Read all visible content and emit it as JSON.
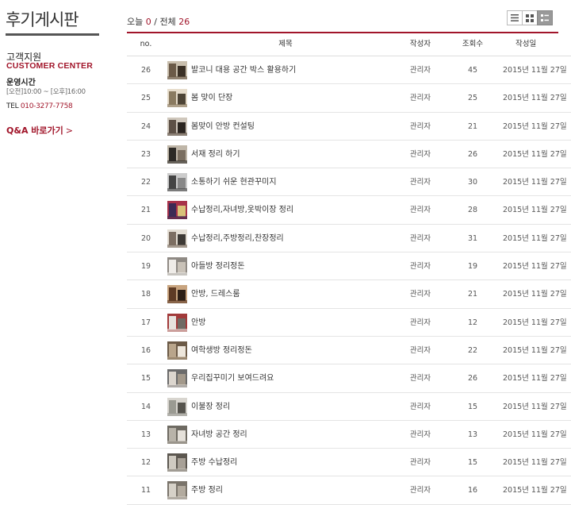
{
  "sidebar": {
    "board_title": "후기게시판",
    "cs_title": "고객지원",
    "cs_en": "CUSTOMER CENTER",
    "hours_label": "운영시간",
    "hours_value": "[오전]10:00 ~ [오후]16:00",
    "tel_label": "TEL",
    "tel_number": "010-3277-7758",
    "qna_link": "Q&A 바로가기",
    "qna_chevron": ">"
  },
  "counts": {
    "today_label": "오늘",
    "today_value": "0",
    "separator": "/",
    "total_label": "전체",
    "total_value": "26"
  },
  "view_modes": [
    "list-view-icon",
    "gallery-view-icon",
    "thumbnail-list-view-icon"
  ],
  "active_view": "thumbnail-list-view-icon",
  "table": {
    "headers": {
      "no": "no.",
      "subject": "제목",
      "writer": "작성자",
      "views": "조회수",
      "date": "작성일"
    },
    "rows": [
      {
        "no": "26",
        "title": "발코니 대용 공간 박스 활용하기",
        "writer": "관리자",
        "views": "45",
        "date": "2015년 11월 27일"
      },
      {
        "no": "25",
        "title": "봄 맞이 단장",
        "writer": "관리자",
        "views": "25",
        "date": "2015년 11월 27일"
      },
      {
        "no": "24",
        "title": "봄맞이 안방 컨설팅",
        "writer": "관리자",
        "views": "21",
        "date": "2015년 11월 27일"
      },
      {
        "no": "23",
        "title": "서재 정리 하기",
        "writer": "관리자",
        "views": "26",
        "date": "2015년 11월 27일"
      },
      {
        "no": "22",
        "title": "소통하기 쉬운 현관꾸미지",
        "writer": "관리자",
        "views": "30",
        "date": "2015년 11월 27일"
      },
      {
        "no": "21",
        "title": "수납정리,자녀방,옷박이장 정리",
        "writer": "관리자",
        "views": "28",
        "date": "2015년 11월 27일"
      },
      {
        "no": "20",
        "title": "수납정리,주방정리,찬장정리",
        "writer": "관리자",
        "views": "31",
        "date": "2015년 11월 27일"
      },
      {
        "no": "19",
        "title": "아들방 정리정돈",
        "writer": "관리자",
        "views": "19",
        "date": "2015년 11월 27일"
      },
      {
        "no": "18",
        "title": "안방, 드레스룸",
        "writer": "관리자",
        "views": "21",
        "date": "2015년 11월 27일"
      },
      {
        "no": "17",
        "title": "안방",
        "writer": "관리자",
        "views": "12",
        "date": "2015년 11월 27일"
      },
      {
        "no": "16",
        "title": "여학생방 정리정돈",
        "writer": "관리자",
        "views": "22",
        "date": "2015년 11월 27일"
      },
      {
        "no": "15",
        "title": "우리집꾸미기 보여드려요",
        "writer": "관리자",
        "views": "26",
        "date": "2015년 11월 27일"
      },
      {
        "no": "14",
        "title": "이불장 정리",
        "writer": "관리자",
        "views": "15",
        "date": "2015년 11월 27일"
      },
      {
        "no": "13",
        "title": "자녀방 공간 정리",
        "writer": "관리자",
        "views": "13",
        "date": "2015년 11월 27일"
      },
      {
        "no": "12",
        "title": "주방 수납정리",
        "writer": "관리자",
        "views": "15",
        "date": "2015년 11월 27일"
      },
      {
        "no": "11",
        "title": "주방 정리",
        "writer": "관리자",
        "views": "16",
        "date": "2015년 11월 27일"
      }
    ]
  },
  "colors": {
    "accent": "#a1152a",
    "rule": "#555555",
    "row_border": "#e4e4e4"
  }
}
